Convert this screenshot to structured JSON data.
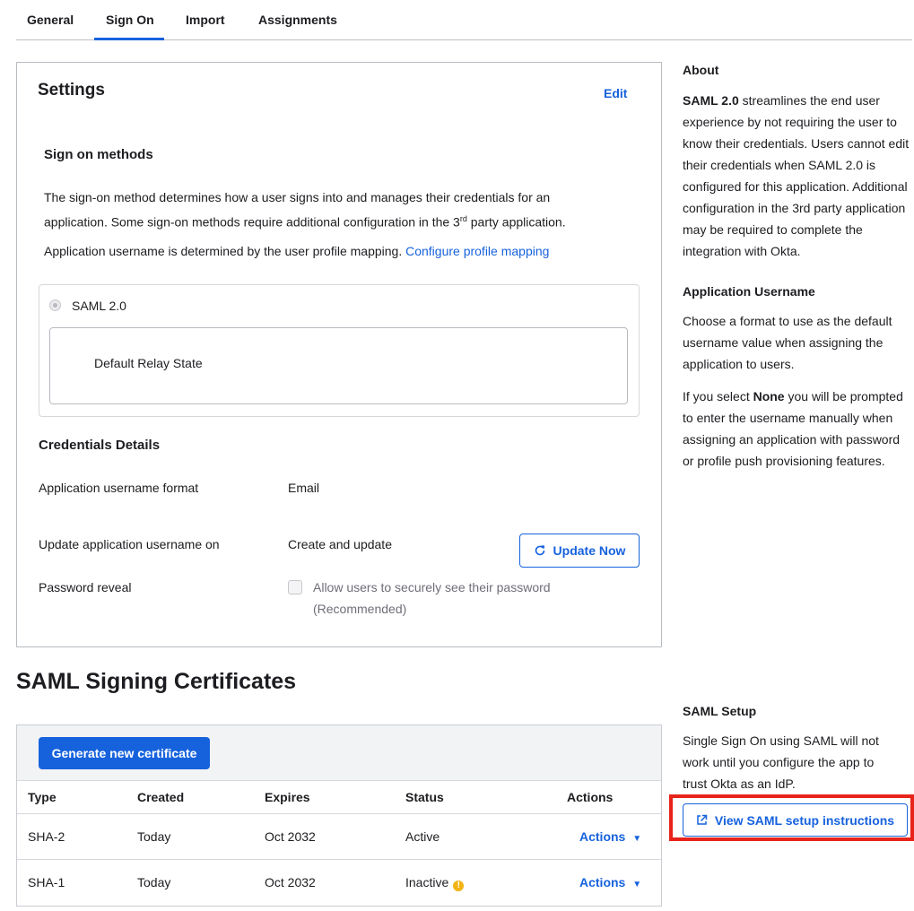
{
  "tabs": [
    {
      "label": "General"
    },
    {
      "label": "Sign On"
    },
    {
      "label": "Import"
    },
    {
      "label": "Assignments"
    }
  ],
  "settings": {
    "title": "Settings",
    "edit_label": "Edit",
    "sign_on_methods": {
      "heading": "Sign on methods",
      "desc_line1": "The sign-on method determines how a user signs into and manages their credentials for an",
      "desc_line2_pre": "application. Some sign-on methods require additional configuration in the 3",
      "desc_line2_sup": "rd",
      "desc_line2_post": " party application.",
      "username_text": "Application username is determined by the user profile mapping.",
      "configure_link": "Configure profile mapping",
      "method_label": "SAML 2.0",
      "relay_state_label": "Default Relay State"
    },
    "credentials": {
      "heading": "Credentials Details",
      "format_label": "Application username format",
      "format_value": "Email",
      "update_label": "Update application username on",
      "update_value": "Create and update",
      "update_button": "Update Now",
      "reveal_label": "Password reveal",
      "reveal_checkbox_line1": "Allow users to securely see their password",
      "reveal_checkbox_line2": "(Recommended)"
    }
  },
  "certificates": {
    "title": "SAML Signing Certificates",
    "generate_button": "Generate new certificate",
    "columns": [
      "Type",
      "Created",
      "Expires",
      "Status",
      "Actions"
    ],
    "rows": [
      {
        "type": "SHA-2",
        "created": "Today",
        "expires": "Oct 2032",
        "status": "Active",
        "actions": "Actions",
        "warning": false
      },
      {
        "type": "SHA-1",
        "created": "Today",
        "expires": "Oct 2032",
        "status": "Inactive",
        "actions": "Actions",
        "warning": true
      }
    ]
  },
  "sidebar": {
    "about_heading": "About",
    "about_bold": "SAML 2.0",
    "about_text": " streamlines the end user experience by not requiring the user to know their credentials. Users cannot edit their credentials when SAML 2.0 is configured for this application. Additional configuration in the 3rd party application may be required to complete the integration with Okta.",
    "username_heading": "Application Username",
    "username_text": "Choose a format to use as the default username value when assigning the application to users.",
    "none_pre": "If you select ",
    "none_bold": "None",
    "none_post": " you will be prompted to enter the username manually when assigning an application with password or profile push provisioning features.",
    "setup_heading": "SAML Setup",
    "setup_text": "Single Sign On using SAML will not work until you configure the app to trust Okta as an IdP.",
    "setup_button": "View SAML setup instructions"
  },
  "colors": {
    "accent": "#1662dd",
    "highlight": "#e8231a",
    "warning": "#f2b314"
  },
  "icons": {
    "refresh": "refresh-icon",
    "external_link": "external-link-icon",
    "caret": "caret-down-icon",
    "warning": "warning-icon"
  }
}
